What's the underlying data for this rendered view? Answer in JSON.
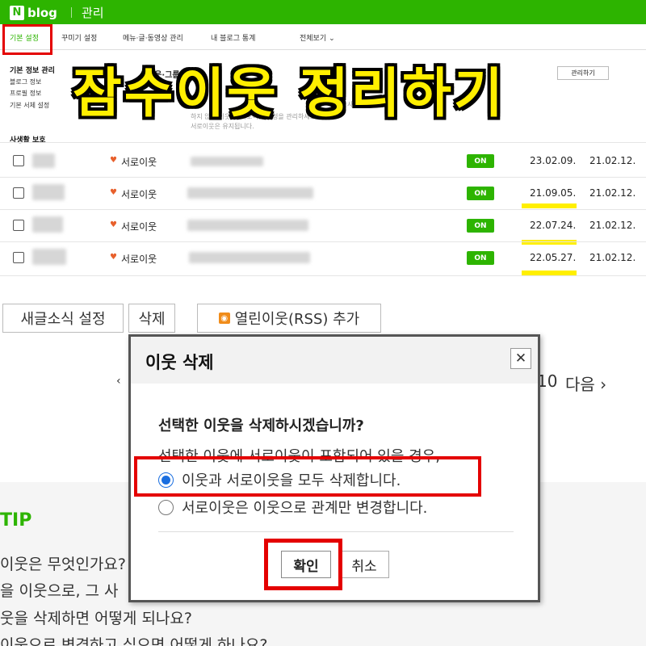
{
  "header": {
    "logo_n": "N",
    "logo_text": "blog",
    "title": "관리"
  },
  "tabs": [
    {
      "label": "기본 설정",
      "active": true
    },
    {
      "label": "꾸미기 설정"
    },
    {
      "label": "메뉴·글·동영상 관리"
    },
    {
      "label": "내 블로그 통계"
    },
    {
      "label": "전체보기",
      "arrow": "⌄"
    }
  ],
  "sidebar": {
    "section1_title": "기본 정보 관리",
    "section1_items": [
      "블로그 정보",
      "프로필 정보",
      "기본 서체 설정"
    ],
    "section2_title": "사생활 보호"
  },
  "overlay_title": "잠수이웃 정리하기",
  "partial": {
    "group_heading": "이웃·그룹 관리",
    "manage_button": "관리하기",
    "hint1": "사용하기",
    "hint2": "하지 않은 이웃 및 서로이웃 신청을 관리하세요.",
    "hint3": "서로이웃은 유지됩니다."
  },
  "rows": [
    {
      "type": "서로이웃",
      "status": "ON",
      "date1": "23.02.09.",
      "date2": "21.02.12."
    },
    {
      "type": "서로이웃",
      "status": "ON",
      "date1": "21.09.05.",
      "date2": "21.02.12."
    },
    {
      "type": "서로이웃",
      "status": "ON",
      "date1": "22.07.24.",
      "date2": "21.02.12."
    },
    {
      "type": "서로이웃",
      "status": "ON",
      "date1": "22.05.27.",
      "date2": "21.02.12."
    }
  ],
  "actions": {
    "new_post": "새글소식 설정",
    "delete": "삭제",
    "rss": "열린이웃(RSS) 추가"
  },
  "pager": {
    "prev": "‹",
    "last_num": "10",
    "next": "다음 ›"
  },
  "tip": {
    "heading": "TIP",
    "lines": [
      "이웃은 무엇인가요?",
      "을 이웃으로, 그 사",
      "웃을 삭제하면 어떻게 되나요?",
      "이웃으로 변경하고 싶으면 어떻게 하나요?"
    ]
  },
  "modal": {
    "title": "이웃 삭제",
    "close": "✕",
    "question": "선택한 이웃을 삭제하시겠습니까?",
    "description": "선택한 이웃에 서로이웃이 포함되어 있을 경우,",
    "option1": "이웃과 서로이웃을 모두 삭제합니다.",
    "option2": "서로이웃은 이웃으로 관계만 변경합니다.",
    "confirm": "확인",
    "cancel": "취소"
  },
  "colors": {
    "brand_green": "#2db400",
    "highlight_red": "#e40000",
    "highlight_yellow": "#ffef00",
    "radio_blue": "#1a6ee0"
  }
}
